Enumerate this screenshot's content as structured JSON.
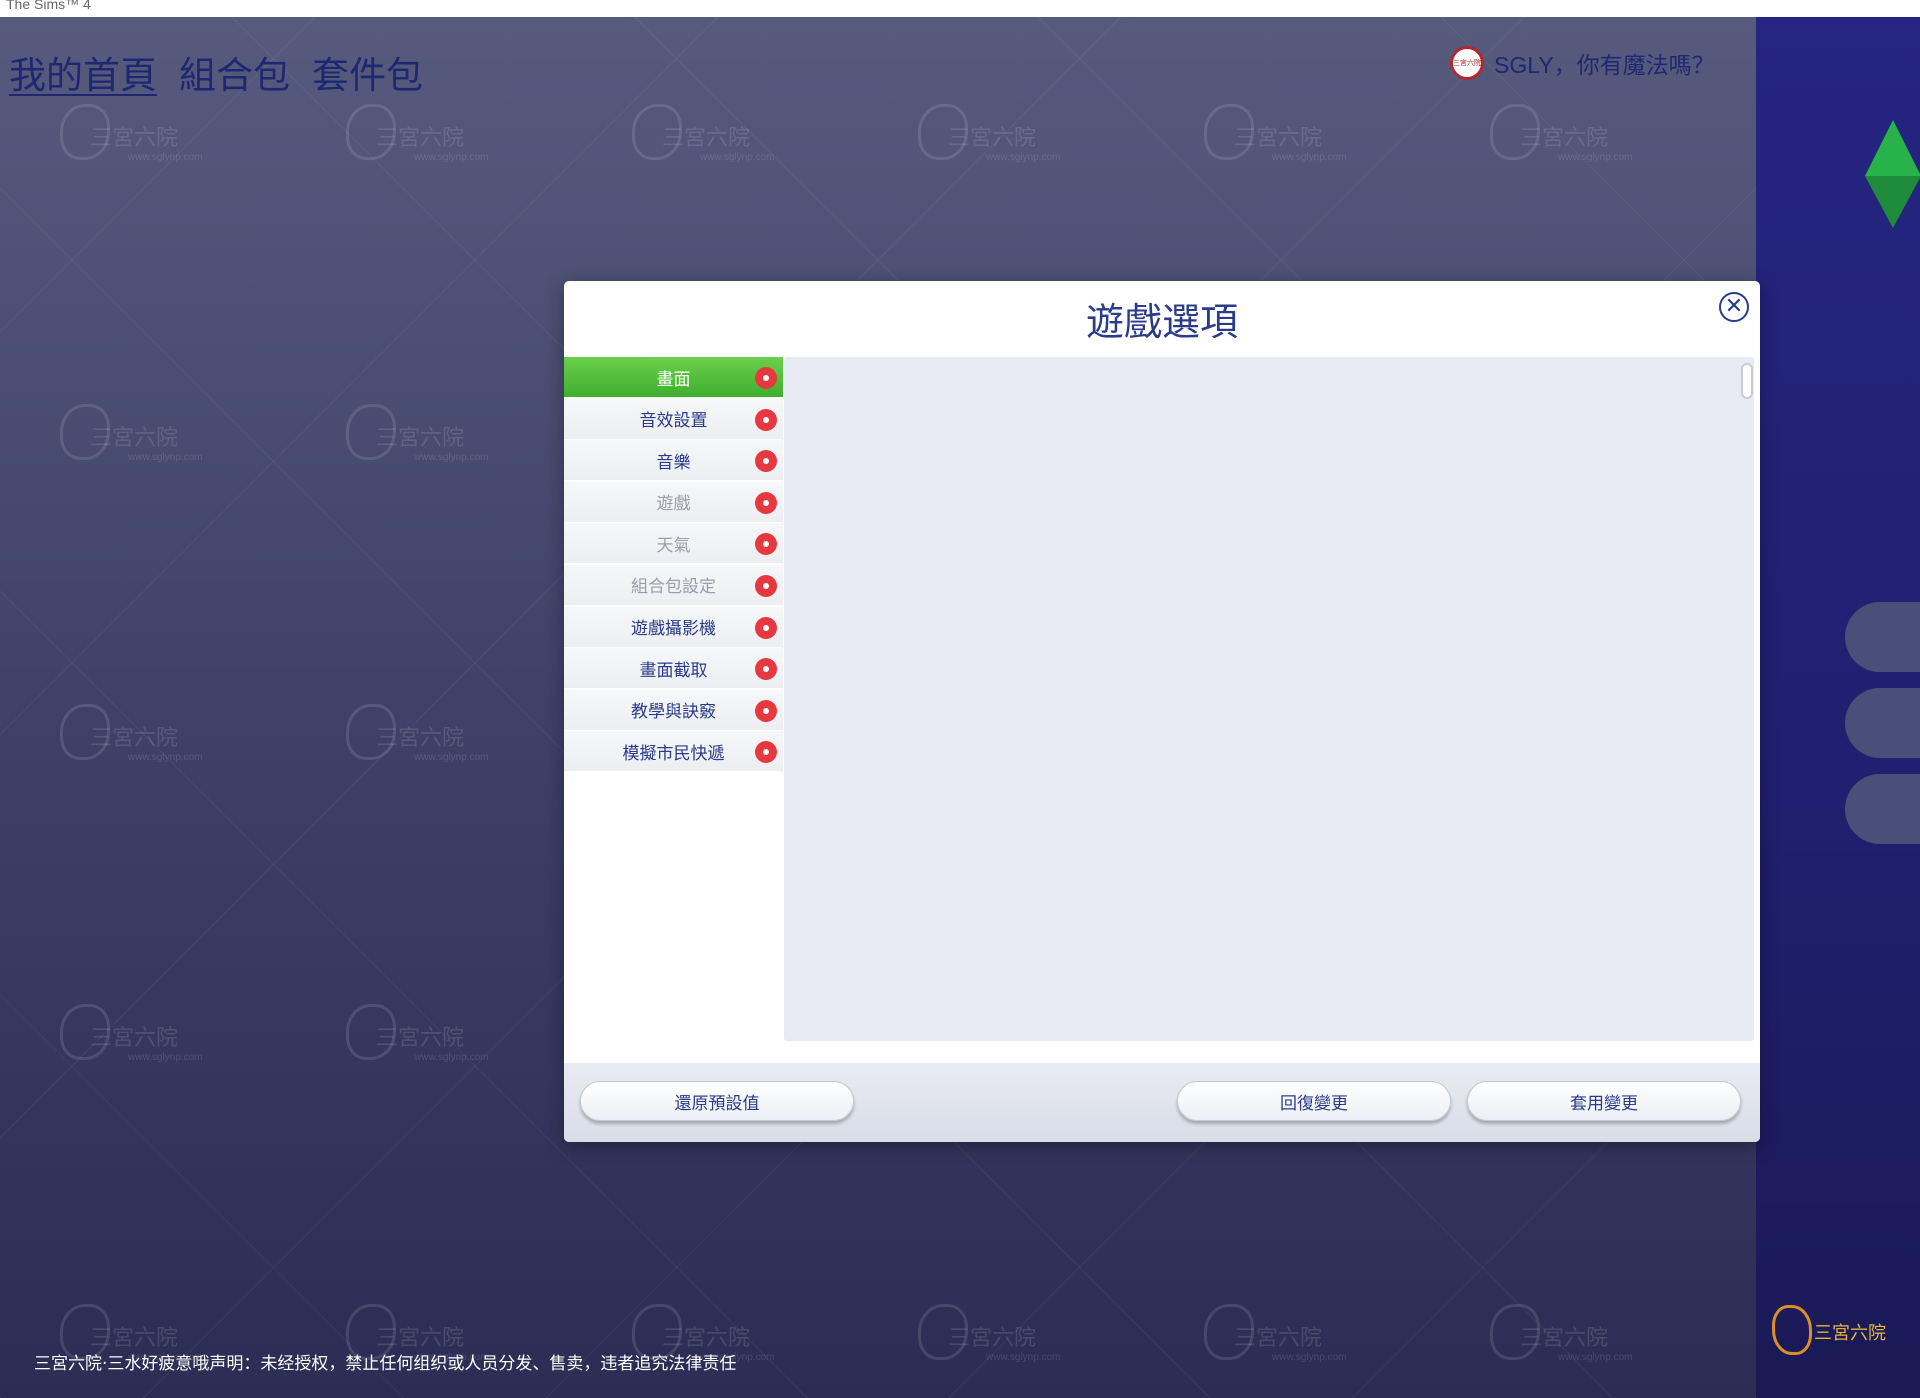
{
  "window": {
    "title": "The Sims™ 4"
  },
  "nav": {
    "items": [
      "我的首頁",
      "組合包",
      "套件包"
    ],
    "active": 0
  },
  "user": {
    "avatar_text": "三宮六院",
    "greeting": "SGLY，你有魔法嗎？"
  },
  "dialog": {
    "title": "遊戲選項",
    "menu": [
      {
        "label": "畫面",
        "state": "active"
      },
      {
        "label": "音效設置",
        "state": "normal"
      },
      {
        "label": "音樂",
        "state": "normal"
      },
      {
        "label": "遊戲",
        "state": "disabled"
      },
      {
        "label": "天氣",
        "state": "disabled"
      },
      {
        "label": "組合包設定",
        "state": "disabled"
      },
      {
        "label": "遊戲攝影機",
        "state": "normal"
      },
      {
        "label": "畫面截取",
        "state": "normal"
      },
      {
        "label": "教學與訣竅",
        "state": "normal"
      },
      {
        "label": "模擬市民快遞",
        "state": "normal"
      }
    ],
    "buttons": {
      "reset": "還原預設值",
      "revert": "回復變更",
      "apply": "套用變更"
    }
  },
  "watermark": {
    "title": "三宮六院",
    "url": "www.sglynp.com"
  },
  "disclaimer": "三宮六院·三水好疲意哦声明：未经授权，禁止任何组织或人员分发、售卖，违者追究法律责任",
  "bottom_logo": {
    "text": "三宮六院"
  },
  "colors": {
    "accent_green": "#3fae2e",
    "badge_red": "#e5383f",
    "text_blue": "#2a3b8a"
  }
}
